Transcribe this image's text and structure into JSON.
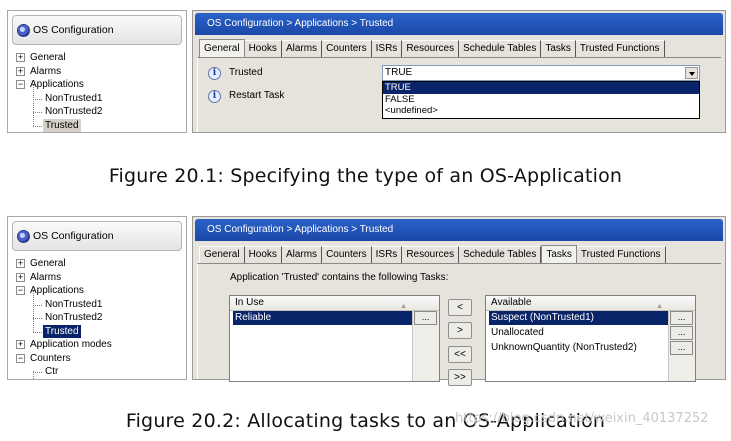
{
  "figure1": {
    "tree": {
      "title": "OS Configuration",
      "items": [
        {
          "label": "General",
          "level": 0,
          "expander": "+"
        },
        {
          "label": "Alarms",
          "level": 0,
          "expander": "+"
        },
        {
          "label": "Applications",
          "level": 0,
          "expander": "−"
        },
        {
          "label": "NonTrusted1",
          "level": 1
        },
        {
          "label": "NonTrusted2",
          "level": 1
        },
        {
          "label": "Trusted",
          "level": 1,
          "selected": true
        }
      ]
    },
    "breadcrumb": "OS Configuration  >  Applications  >  Trusted",
    "tabs": [
      "General",
      "Hooks",
      "Alarms",
      "Counters",
      "ISRs",
      "Resources",
      "Schedule Tables",
      "Tasks",
      "Trusted Functions"
    ],
    "active_tab": "General",
    "fields": {
      "trusted_label": "Trusted",
      "restart_label": "Restart Task",
      "trusted_value": "TRUE",
      "options": [
        "TRUE",
        "FALSE",
        "<undefined>"
      ]
    }
  },
  "caption1": "Figure 20.1: Specifying the type of an OS-Application",
  "figure2": {
    "tree": {
      "title": "OS Configuration",
      "items": [
        {
          "label": "General",
          "level": 0,
          "expander": "+"
        },
        {
          "label": "Alarms",
          "level": 0,
          "expander": "+"
        },
        {
          "label": "Applications",
          "level": 0,
          "expander": "−"
        },
        {
          "label": "NonTrusted1",
          "level": 1
        },
        {
          "label": "NonTrusted2",
          "level": 1
        },
        {
          "label": "Trusted",
          "level": 1,
          "selected": true
        },
        {
          "label": "Application modes",
          "level": 0,
          "expander": "+"
        },
        {
          "label": "Counters",
          "level": 0,
          "expander": "−"
        },
        {
          "label": "Ctr",
          "level": 1
        }
      ]
    },
    "breadcrumb": "OS Configuration  >  Applications  >  Trusted",
    "tabs": [
      "General",
      "Hooks",
      "Alarms",
      "Counters",
      "ISRs",
      "Resources",
      "Schedule Tables",
      "Tasks",
      "Trusted Functions"
    ],
    "active_tab": "Tasks",
    "description": "Application 'Trusted' contains the following Tasks:",
    "in_use": {
      "header": "In Use",
      "rows": [
        "Reliable"
      ]
    },
    "available": {
      "header": "Available",
      "rows": [
        "Suspect (NonTrusted1)",
        "Unallocated",
        "UnknownQuantity (NonTrusted2)"
      ]
    },
    "buttons": {
      "remove": "<",
      "add": ">",
      "remove_all": "<<",
      "add_all": ">>",
      "ellipsis": "..."
    }
  },
  "caption2": "Figure 20.2: Allocating tasks to an OS-Application",
  "watermark": "https://blog.csdn.net/weixin_40137252"
}
